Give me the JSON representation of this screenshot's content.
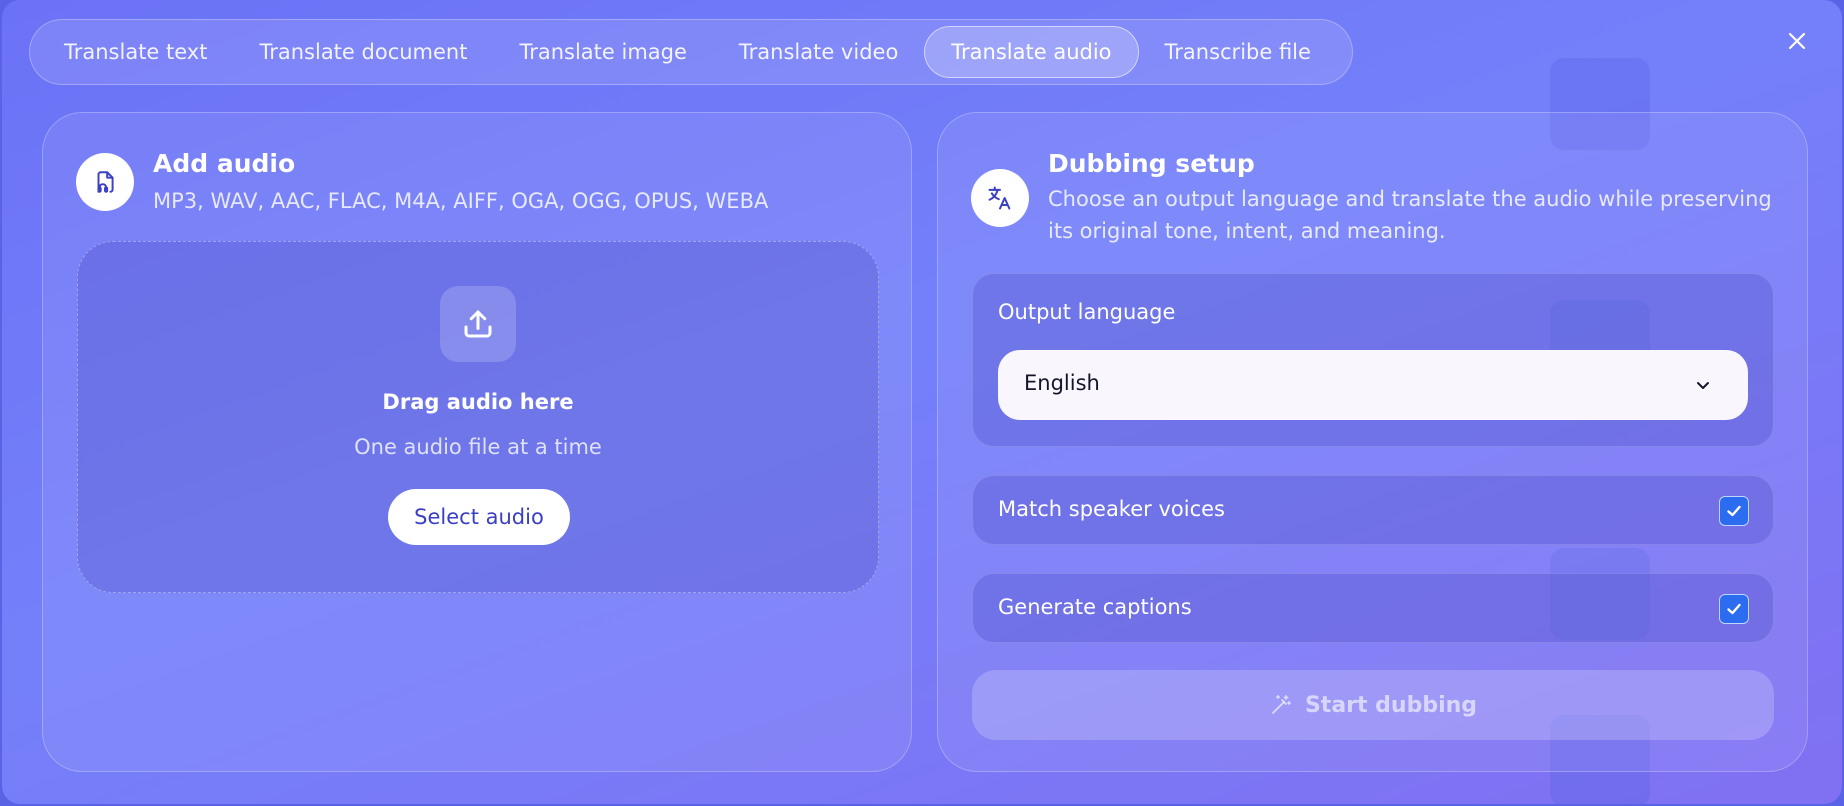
{
  "tabs": [
    {
      "label": "Translate text",
      "active": false
    },
    {
      "label": "Translate document",
      "active": false
    },
    {
      "label": "Translate image",
      "active": false
    },
    {
      "label": "Translate video",
      "active": false
    },
    {
      "label": "Translate audio",
      "active": true
    },
    {
      "label": "Transcribe file",
      "active": false
    }
  ],
  "close_icon": "close-icon",
  "add_audio": {
    "icon": "audio-file-icon",
    "title": "Add audio",
    "formats": "MP3, WAV, AAC, FLAC, M4A, AIFF, OGA, OGG, OPUS, WEBA",
    "dropzone": {
      "icon": "upload-icon",
      "title": "Drag audio here",
      "subtitle": "One audio file at a time",
      "button_label": "Select audio"
    }
  },
  "dubbing": {
    "icon": "translate-icon",
    "title": "Dubbing setup",
    "description": "Choose an output language and translate the audio while preserving its original tone, intent, and meaning.",
    "output_language": {
      "label": "Output language",
      "value": "English"
    },
    "match_speaker_voices": {
      "label": "Match speaker voices",
      "checked": true
    },
    "generate_captions": {
      "label": "Generate captions",
      "checked": true
    },
    "start_button": {
      "label": "Start dubbing",
      "icon": "magic-wand-icon",
      "enabled": false
    }
  },
  "colors": {
    "accent_checkbox": "#2b6cf0",
    "button_text": "#3b3fc4"
  }
}
